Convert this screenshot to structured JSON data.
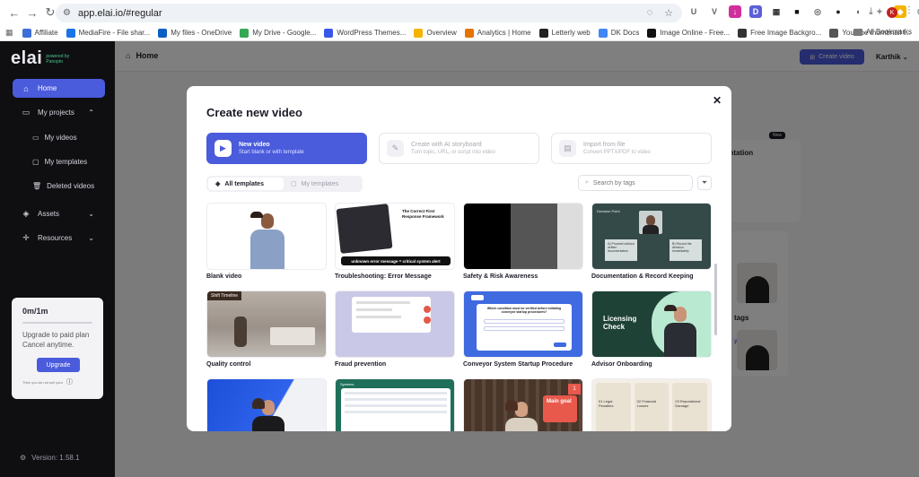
{
  "browser": {
    "url": "app.elai.io/#regular",
    "bookmarks": [
      {
        "label": "Affiliate",
        "color": "#3d6fd8"
      },
      {
        "label": "MediaFire - File shar...",
        "color": "#1a73e8"
      },
      {
        "label": "My files - OneDrive",
        "color": "#0a5fc2"
      },
      {
        "label": "My Drive - Google...",
        "color": "#34a853"
      },
      {
        "label": "WordPress Themes...",
        "color": "#3858e9"
      },
      {
        "label": "Overview",
        "color": "#f4b400"
      },
      {
        "label": "Analytics | Home",
        "color": "#e37400"
      },
      {
        "label": "Letterly web",
        "color": "#222222"
      },
      {
        "label": "DK Docs",
        "color": "#4285f4"
      },
      {
        "label": "Image Online - Free...",
        "color": "#111111"
      },
      {
        "label": "Free Image Backgro...",
        "color": "#333333"
      },
      {
        "label": "Youtube thumbnail l...",
        "color": "#555555"
      }
    ],
    "all_bookmarks": "All Bookmarks",
    "extensions": [
      {
        "glyph": "U",
        "color": "#ffffff",
        "text": "#5f6368"
      },
      {
        "glyph": "V",
        "color": "#ffffff",
        "text": "#5f6368"
      },
      {
        "glyph": "↓",
        "color": "#d12f9c",
        "text": "#ffffff"
      },
      {
        "glyph": "D",
        "color": "#5b5fd9",
        "text": "#ffffff"
      },
      {
        "glyph": "▦",
        "color": "#ffffff",
        "text": "#333333"
      },
      {
        "glyph": "■",
        "color": "#ffffff",
        "text": "#111111"
      },
      {
        "glyph": "◎",
        "color": "#ffffff",
        "text": "#5f6368"
      },
      {
        "glyph": "●",
        "color": "#ffffff",
        "text": "#222222"
      },
      {
        "glyph": "◐",
        "color": "#ffffff",
        "text": "#555555"
      },
      {
        "glyph": "✦",
        "color": "#ffffff",
        "text": "#888888"
      },
      {
        "glyph": "◆",
        "color": "#f4b400",
        "text": "#ffffff"
      },
      {
        "glyph": "⬡",
        "color": "#ffffff",
        "text": "#5f6368"
      }
    ],
    "profile_initial": "K"
  },
  "sidebar": {
    "logo": "elai",
    "logo_tag": "powered by Panopto",
    "items": [
      {
        "label": "Home"
      },
      {
        "label": "My projects"
      },
      {
        "label": "My videos"
      },
      {
        "label": "My templates"
      },
      {
        "label": "Deleted videos"
      },
      {
        "label": "Assets"
      },
      {
        "label": "Resources"
      }
    ],
    "plan": {
      "usage": "0m/1m",
      "progress_fraction": 0,
      "message": "Upgrade to paid plan Cancel anytime.",
      "upgrade_label": "Upgrade",
      "footer": "Then you do not sell your"
    },
    "version": "Version: 1.58.1"
  },
  "header": {
    "title": "Home",
    "create_label": "Create video",
    "user": "Karthik"
  },
  "background": {
    "new_badge": "New",
    "presentation_text": "entation",
    "tags_text": "tags",
    "your_text": "your"
  },
  "modal": {
    "title": "Create new video",
    "options": [
      {
        "title": "New video",
        "subtitle": "Start blank or with template"
      },
      {
        "title": "Create with AI storyboard",
        "subtitle": "Turn topic, URL, or script into video"
      },
      {
        "title": "Import from file",
        "subtitle": "Convert PPTX/PDF to video"
      }
    ],
    "tabs": [
      "All templates",
      "My templates"
    ],
    "search_placeholder": "Search by tags",
    "templates": [
      {
        "label": "Blank video"
      },
      {
        "label": "Troubleshooting: Error Message",
        "headline": "The Correct First Response Framework",
        "caption": "unknown error message = critical system alert"
      },
      {
        "label": "Safety & Risk Awareness"
      },
      {
        "label": "Documentation & Record Keeping",
        "tag": "Decision Point",
        "left": "A) Proceed without written documentation",
        "right": "B) Record the decision immediately"
      },
      {
        "label": "Quality control",
        "tag": "Shift Timeline"
      },
      {
        "label": "Fraud prevention"
      },
      {
        "label": "Conveyor System Startup Procedure",
        "headline": "Which condition must be verified before initiating conveyor startup procedures?"
      },
      {
        "label": "Advisor Onboarding",
        "headline": "Licensing Check"
      },
      {
        "label": ""
      },
      {
        "label": "",
        "tag": "Systems"
      },
      {
        "label": "",
        "headline": "Main goal",
        "number": "1"
      },
      {
        "label": "",
        "steps": [
          "01 Legal Penalties",
          "02 Financial Losses",
          "03 Reputational Damage"
        ]
      }
    ]
  },
  "colors": {
    "accent": "#4a5bdc",
    "sidebar_bg": "#0f0f12",
    "brand_green": "#45c78b"
  }
}
